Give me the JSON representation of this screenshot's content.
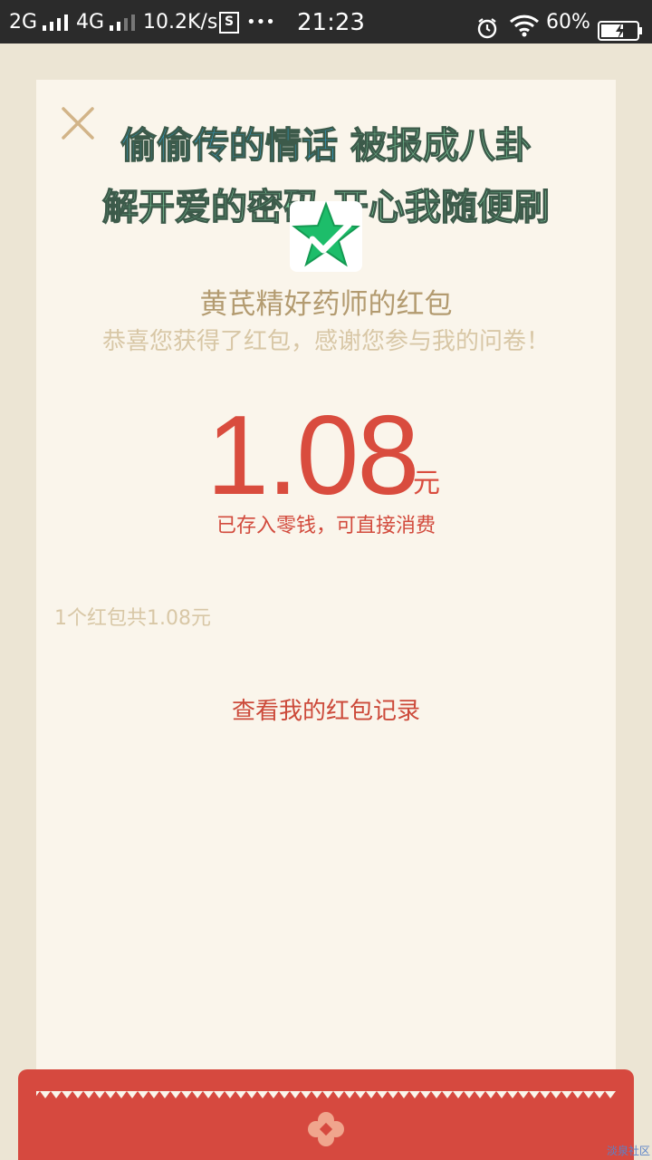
{
  "status_bar": {
    "net1": "2G",
    "net2": "4G",
    "speed": "10.2K/s",
    "s_badge": "S",
    "more": "•••",
    "time": "21:23",
    "battery": "60%"
  },
  "banner": {
    "line1_part1": "偷偷传的情话",
    "line1_part2": "被报成八卦",
    "line2": "解开爱的密码 开心我随便刷"
  },
  "sender_name": "黄芪精好药师的红包",
  "greeting": "恭喜您获得了红包，感谢您参与我的问卷！",
  "amount": "1.08",
  "unit": "元",
  "deposit_note": "已存入零钱，可直接消费",
  "summary": "1个红包共1.08元",
  "records_link": "查看我的红包记录",
  "watermark": "淡泉社区",
  "colors": {
    "accent_red": "#d94c3e",
    "gold": "#b39b70",
    "page_bg": "#ece5d4",
    "card_bg": "#faf5eb"
  },
  "icons": [
    "close-icon",
    "alarm-icon",
    "wifi-icon",
    "battery-icon",
    "star-check-icon",
    "flower-icon"
  ]
}
